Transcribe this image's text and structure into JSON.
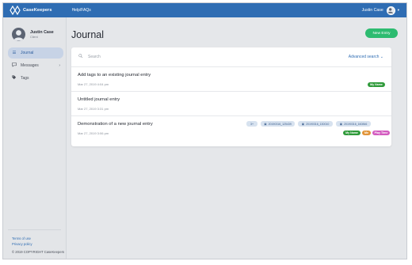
{
  "topbar": {
    "brand": "CaseKeepers",
    "help_link": "Help/FAQs",
    "user_name": "Justin Case",
    "accent_color": "#2f6db3"
  },
  "sidebar": {
    "profile_name": "Justin Case",
    "profile_role": "Client",
    "items": [
      {
        "label": "Journal",
        "icon": "list-icon",
        "active": true
      },
      {
        "label": "Messages",
        "icon": "chat-icon",
        "active": false
      },
      {
        "label": "Tags",
        "icon": "tag-icon",
        "active": false
      }
    ],
    "terms": "Terms of use",
    "privacy": "Privacy policy",
    "copyright": "© 2019 COPYRIGHT CaseKeepers"
  },
  "main": {
    "title": "Journal",
    "new_entry": "New Entry",
    "new_entry_color": "#2dbb70",
    "search_placeholder": "Search",
    "advanced_search": "Advanced search",
    "entries": [
      {
        "title": "Add tags to an existing journal entry",
        "date": "Mar 27, 2019 4:04 pm",
        "tags": [
          "My Name"
        ]
      },
      {
        "title": "Untitled journal entry",
        "date": "Mar 27, 2019 3:31 pm",
        "tags": []
      },
      {
        "title": "Demonstration of a new journal entry",
        "date": "Mar 27, 2019 3:06 pm",
        "attachment_count": "3+",
        "attachments": [
          "20190316_125439",
          "20190316_130010",
          "20190316_160846"
        ],
        "tags": [
          "My Name",
          "Me",
          "Play Time"
        ]
      }
    ]
  }
}
